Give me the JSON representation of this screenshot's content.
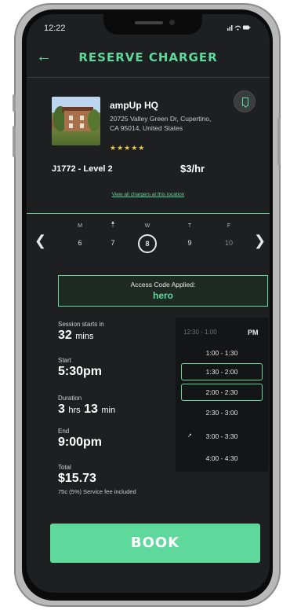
{
  "status_bar": {
    "time": "12:22",
    "icons": "▐▌ ◠ ▭"
  },
  "header": {
    "title": "RESERVE CHARGER",
    "back_icon": "back-arrow-icon"
  },
  "location": {
    "name": "ampUp HQ",
    "address": "20725 Valley Green Dr, Cupertino, CA 95014, United States",
    "rating_stars": "★★★★★",
    "rating": 5,
    "charger_type": "J1772 - Level 2",
    "price": "$3/hr",
    "view_all_link": "View all chargers at this location"
  },
  "calendar": {
    "days": [
      {
        "dow": "M",
        "date": "6",
        "muted": false
      },
      {
        "dow": "T",
        "date": "7",
        "muted": false,
        "today": true
      },
      {
        "dow": "W",
        "date": "8",
        "selected": true
      },
      {
        "dow": "T",
        "date": "9",
        "muted": false
      },
      {
        "dow": "F",
        "date": "10",
        "muted": true
      }
    ],
    "prev_icon": "chevron-left-icon",
    "next_icon": "chevron-right-icon"
  },
  "access": {
    "label": "Access Code Applied:",
    "code": "hero"
  },
  "session": {
    "starts_in_label": "Session starts in",
    "starts_in_value": "32",
    "starts_in_unit": "mins",
    "start_label": "Start",
    "start_value": "5:30pm",
    "duration_label": "Duration",
    "duration_h": "3",
    "duration_h_unit": "hrs",
    "duration_m": "13",
    "duration_m_unit": "min",
    "end_label": "End",
    "end_value": "9:00pm",
    "total_label": "Total",
    "total_value": "$15.73",
    "fee_note": "75c (5%) Service fee included"
  },
  "slots": {
    "header": "12:30 - 1:00",
    "period": "PM",
    "items": [
      {
        "label": "1:00 - 1:30",
        "selected": false
      },
      {
        "label": "1:30 - 2:00",
        "selected": true
      },
      {
        "label": "2:00 - 2:30",
        "selected": true
      },
      {
        "label": "2:30 - 3:00",
        "selected": false
      },
      {
        "label": "3:00 - 3:30",
        "selected": false
      },
      {
        "label": "4:00 - 4:30",
        "selected": false
      }
    ]
  },
  "book_button": "BOOK",
  "colors": {
    "accent": "#5fd99b",
    "background": "#1d1f20",
    "star": "#e9c64a"
  }
}
